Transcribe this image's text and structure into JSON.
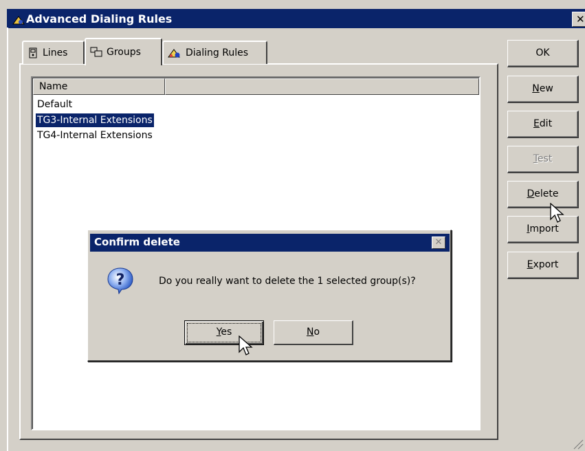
{
  "window": {
    "title": "Advanced Dialing Rules",
    "close_glyph": "✕"
  },
  "tabs": [
    {
      "label": "Lines",
      "icon": "phone-icon"
    },
    {
      "label": "Groups",
      "icon": "groups-icon"
    },
    {
      "label": "Dialing Rules",
      "icon": "dialing-rules-icon"
    }
  ],
  "list": {
    "columns": [
      "Name",
      ""
    ],
    "items": [
      "Default",
      "TG3-Internal Extensions",
      "TG4-Internal Extensions"
    ],
    "selected": "TG3-Internal Extensions"
  },
  "buttons": {
    "ok": "OK",
    "new": {
      "mnemonic": "N",
      "rest": "ew"
    },
    "edit": {
      "mnemonic": "E",
      "rest": "dit"
    },
    "test": {
      "mnemonic": "T",
      "rest": "est"
    },
    "delete": {
      "mnemonic": "D",
      "rest": "elete"
    },
    "import": {
      "mnemonic": "I",
      "rest": "mport"
    },
    "export": {
      "mnemonic": "E",
      "rest": "xport"
    }
  },
  "dialog": {
    "title": "Confirm delete",
    "message": "Do you really want to delete the 1 selected group(s)?",
    "icon": "question-icon",
    "yes": {
      "mnemonic": "Y",
      "rest": "es"
    },
    "no": {
      "mnemonic": "N",
      "rest": "o"
    },
    "close_glyph": "✕"
  },
  "colors": {
    "titlebar": "#0a246a",
    "face": "#d4d0c8",
    "selection": "#0a246a"
  }
}
